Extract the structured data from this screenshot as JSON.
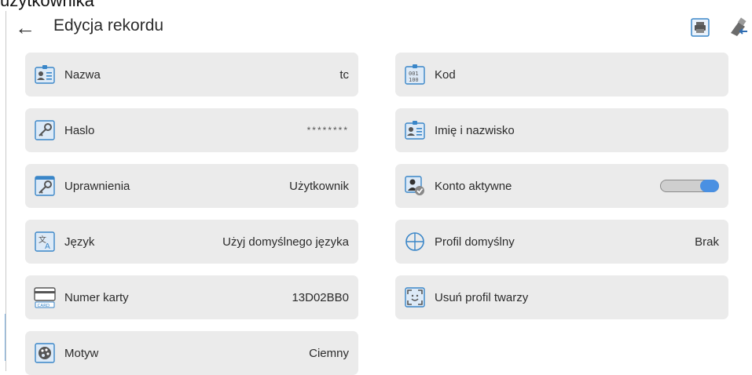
{
  "caption": "użytkownika",
  "header": {
    "back_icon": "arrow-left-icon",
    "title": "Edycja rekordu",
    "print_icon": "printer-icon",
    "export_icon": "usb-export-icon"
  },
  "tiles": {
    "nazwa": {
      "label": "Nazwa",
      "value": "tc",
      "icon": "id-card-icon"
    },
    "haslo": {
      "label": "Haslo",
      "value": "********",
      "icon": "key-icon"
    },
    "uprawnienia": {
      "label": "Uprawnienia",
      "value": "Użytkownik",
      "icon": "key-window-icon"
    },
    "jezyk": {
      "label": "Język",
      "value": "Użyj domyślnego języka",
      "icon": "translate-icon"
    },
    "numer_karty": {
      "label": "Numer karty",
      "value": "13D02BB0",
      "icon": "card-icon"
    },
    "motyw": {
      "label": "Motyw",
      "value": "Ciemny",
      "icon": "palette-icon"
    },
    "kod": {
      "label": "Kod",
      "icon": "binary-code-icon"
    },
    "imie": {
      "label": "Imię i nazwisko",
      "icon": "id-card-icon"
    },
    "konto": {
      "label": "Konto aktywne",
      "icon": "user-check-icon",
      "toggle_on": true
    },
    "profil": {
      "label": "Profil domyślny",
      "value": "Brak",
      "icon": "profile-circle-icon"
    },
    "twarz": {
      "label": "Usuń profil twarzy",
      "icon": "face-scan-icon"
    }
  },
  "colors": {
    "accent": "#4a90e2",
    "tile_bg": "#ebebeb",
    "icon_blue": "#3a86c8"
  }
}
